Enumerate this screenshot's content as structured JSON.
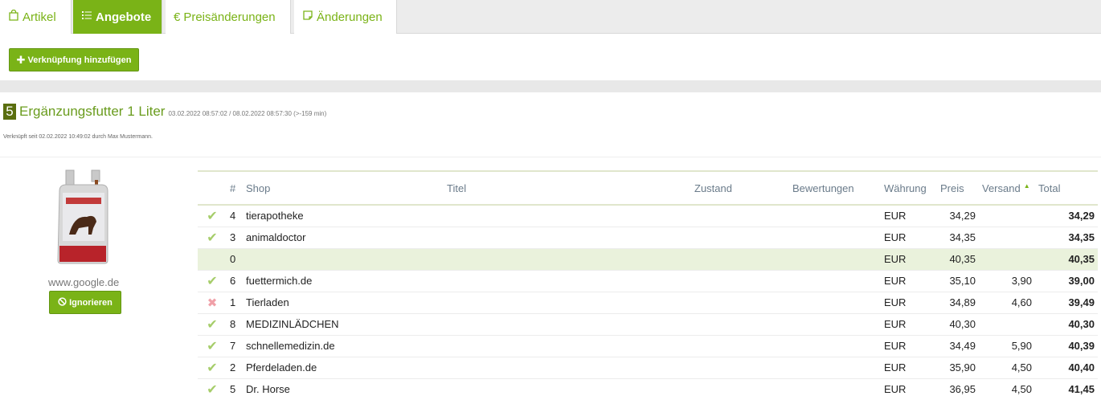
{
  "tabs": [
    {
      "label": "Artikel",
      "active": false,
      "icon": "bag-icon"
    },
    {
      "label": "Angebote",
      "active": true,
      "icon": "list-icon"
    },
    {
      "label": "Preisänderungen",
      "active": false,
      "icon": "euro-icon"
    },
    {
      "label": "Änderungen",
      "active": false,
      "icon": "note-icon"
    }
  ],
  "toolbar": {
    "add_link_label": "Verknüpfung hinzufügen"
  },
  "product": {
    "count": "5",
    "title": "Ergänzungsfutter 1 Liter",
    "meta": "03.02.2022 08:57:02 / 08.02.2022 08:57:30 (>-159 min)",
    "linked_info": "Verknüpft seit 02.02.2022 10:49:02 durch Max Mustermann.",
    "source": "www.google.de",
    "ignore_label": "Ignorieren"
  },
  "table": {
    "headers": {
      "num": "#",
      "shop": "Shop",
      "title": "Titel",
      "condition": "Zustand",
      "ratings": "Bewertungen",
      "currency": "Währung",
      "price": "Preis",
      "shipping": "Versand",
      "total": "Total"
    },
    "rows": [
      {
        "status": "check",
        "num": "4",
        "shop": "tierapotheke",
        "title": "",
        "condition": "",
        "ratings": "",
        "currency": "EUR",
        "price": "34,29",
        "shipping": "",
        "total": "34,29"
      },
      {
        "status": "check",
        "num": "3",
        "shop": "animaldoctor",
        "title": "",
        "condition": "",
        "ratings": "",
        "currency": "EUR",
        "price": "34,35",
        "shipping": "",
        "total": "34,35"
      },
      {
        "status": "none",
        "num": "0",
        "shop": "",
        "title": "",
        "condition": "",
        "ratings": "",
        "currency": "EUR",
        "price": "40,35",
        "shipping": "",
        "total": "40,35",
        "highlight": true
      },
      {
        "status": "check",
        "num": "6",
        "shop": "fuettermich.de",
        "title": "",
        "condition": "",
        "ratings": "",
        "currency": "EUR",
        "price": "35,10",
        "shipping": "3,90",
        "total": "39,00"
      },
      {
        "status": "cross",
        "num": "1",
        "shop": "Tierladen",
        "title": "",
        "condition": "",
        "ratings": "",
        "currency": "EUR",
        "price": "34,89",
        "shipping": "4,60",
        "total": "39,49"
      },
      {
        "status": "check",
        "num": "8",
        "shop": "MEDIZINLÄDCHEN",
        "title": "",
        "condition": "",
        "ratings": "",
        "currency": "EUR",
        "price": "40,30",
        "shipping": "",
        "total": "40,30"
      },
      {
        "status": "check",
        "num": "7",
        "shop": "schnellemedizin.de",
        "title": "",
        "condition": "",
        "ratings": "",
        "currency": "EUR",
        "price": "34,49",
        "shipping": "5,90",
        "total": "40,39"
      },
      {
        "status": "check",
        "num": "2",
        "shop": "Pferdeladen.de",
        "title": "",
        "condition": "",
        "ratings": "",
        "currency": "EUR",
        "price": "35,90",
        "shipping": "4,50",
        "total": "40,40"
      },
      {
        "status": "check",
        "num": "5",
        "shop": "Dr. Horse",
        "title": "",
        "condition": "",
        "ratings": "",
        "currency": "EUR",
        "price": "36,95",
        "shipping": "4,50",
        "total": "41,45"
      }
    ]
  },
  "colors": {
    "accent": "#7ab317",
    "badge": "#5a6e0f",
    "highlight_row": "#eaf2dc",
    "check": "#a6cd6a",
    "cross": "#f0a0a8"
  }
}
